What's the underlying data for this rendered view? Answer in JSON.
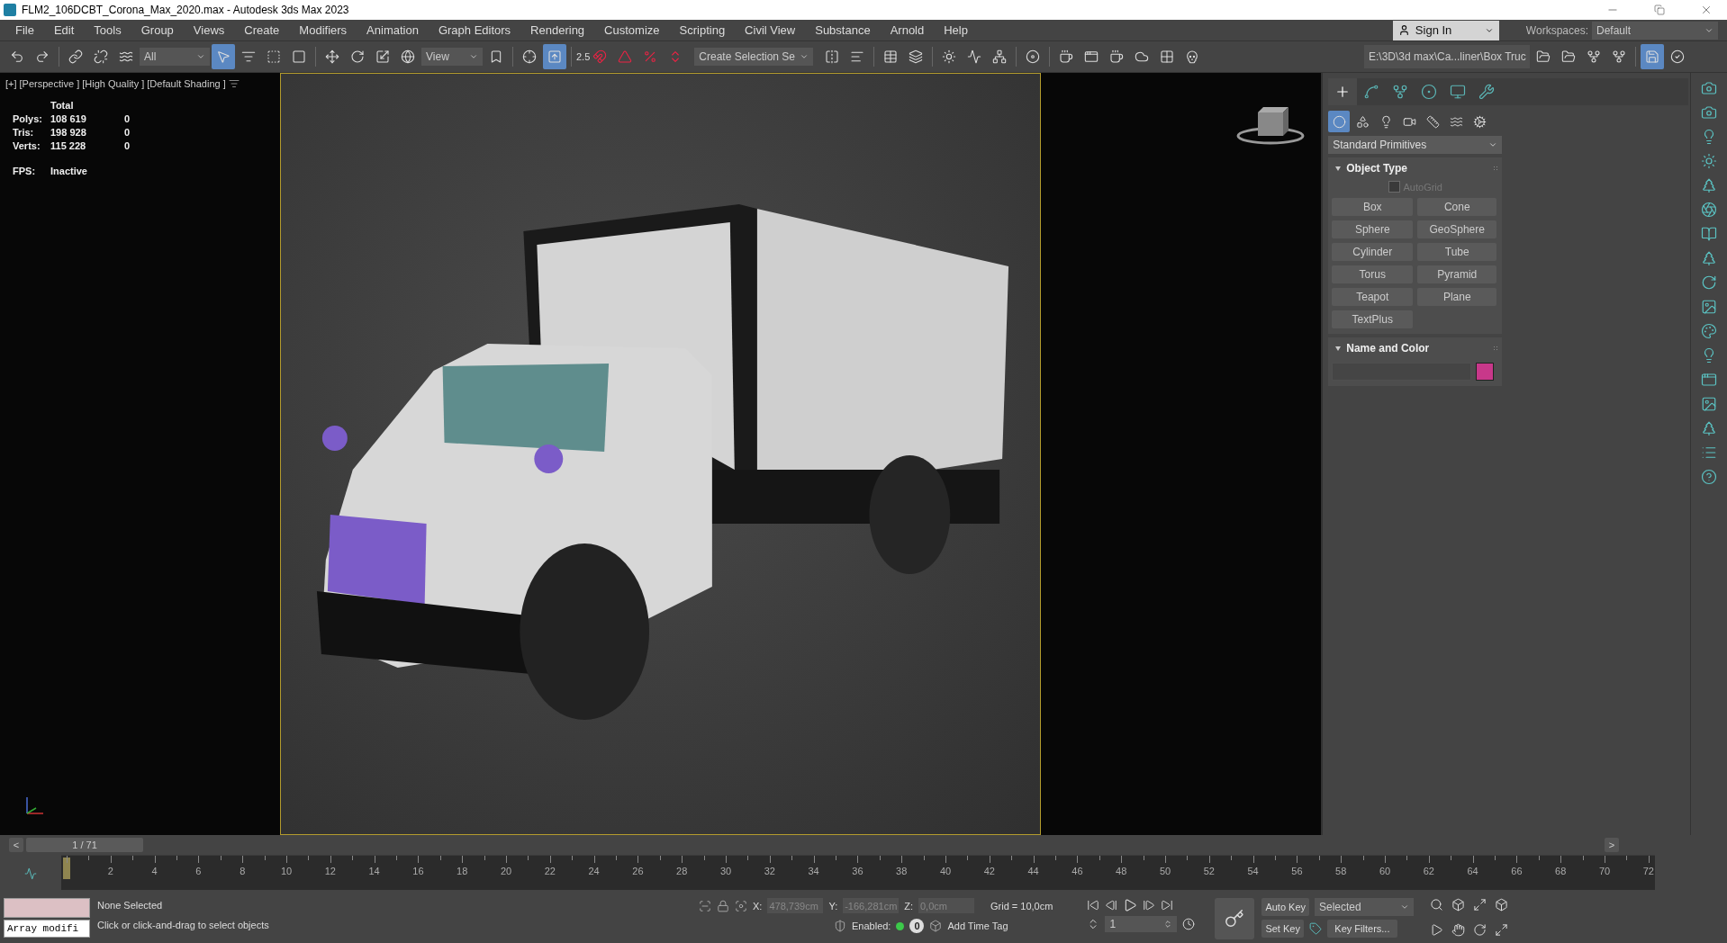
{
  "window": {
    "title": "FLM2_106DCBT_Corona_Max_2020.max - Autodesk 3ds Max 2023"
  },
  "menu": [
    "File",
    "Edit",
    "Tools",
    "Group",
    "Views",
    "Create",
    "Modifiers",
    "Animation",
    "Graph Editors",
    "Rendering",
    "Customize",
    "Scripting",
    "Civil View",
    "Substance",
    "Arnold",
    "Help"
  ],
  "account": {
    "sign_in": "Sign In",
    "workspaces_label": "Workspaces:",
    "workspace": "Default"
  },
  "toolbar": {
    "selection_filter": "All",
    "reference_coord": "View",
    "snap_label": "2.5",
    "selection_set": "Create Selection Se",
    "project_path": "E:\\3D\\3d max\\Ca...liner\\Box Truc",
    "tools": [
      {
        "kind": "undo",
        "selected": false
      },
      {
        "kind": "redo",
        "selected": false
      },
      {
        "kind": "sep"
      },
      {
        "kind": "link",
        "selected": false
      },
      {
        "kind": "unlink",
        "selected": false
      },
      {
        "kind": "bind",
        "selected": false
      },
      {
        "kind": "filter"
      },
      {
        "kind": "select",
        "selected": true
      },
      {
        "kind": "select-name",
        "selected": false
      },
      {
        "kind": "region",
        "selected": false
      },
      {
        "kind": "window",
        "selected": false
      },
      {
        "kind": "sep"
      },
      {
        "kind": "move",
        "selected": false
      },
      {
        "kind": "rotate",
        "selected": false
      },
      {
        "kind": "scale",
        "selected": false
      },
      {
        "kind": "place",
        "selected": false
      },
      {
        "kind": "coord"
      },
      {
        "kind": "bookmark",
        "selected": false
      },
      {
        "kind": "sep"
      },
      {
        "kind": "pivot",
        "selected": false
      },
      {
        "kind": "override",
        "selected": true
      },
      {
        "kind": "sep"
      },
      {
        "kind": "snap",
        "selected": false
      },
      {
        "kind": "angle",
        "selected": false
      },
      {
        "kind": "percent",
        "selected": false
      },
      {
        "kind": "spinner",
        "selected": false
      },
      {
        "kind": "selset"
      },
      {
        "kind": "mirror",
        "selected": false
      },
      {
        "kind": "align",
        "selected": false
      },
      {
        "kind": "sep"
      },
      {
        "kind": "table",
        "selected": false
      },
      {
        "kind": "layers",
        "selected": false
      },
      {
        "kind": "sep"
      },
      {
        "kind": "sun",
        "selected": false
      },
      {
        "kind": "curve",
        "selected": false
      },
      {
        "kind": "schematic",
        "selected": false
      },
      {
        "kind": "sep"
      },
      {
        "kind": "material",
        "selected": false
      },
      {
        "kind": "sep"
      },
      {
        "kind": "render-setup",
        "selected": false
      },
      {
        "kind": "frame-window",
        "selected": false
      },
      {
        "kind": "render",
        "selected": false
      },
      {
        "kind": "render-cloud",
        "selected": false
      },
      {
        "kind": "grid",
        "selected": false
      },
      {
        "kind": "skull",
        "selected": false
      },
      {
        "kind": "path"
      },
      {
        "kind": "folder",
        "selected": false
      },
      {
        "kind": "folder",
        "selected": false
      },
      {
        "kind": "hierarchy",
        "selected": false
      },
      {
        "kind": "hierarchy",
        "selected": false
      },
      {
        "kind": "sep"
      },
      {
        "kind": "save",
        "selected": true
      },
      {
        "kind": "check"
      }
    ]
  },
  "viewport": {
    "labels": [
      "[+]",
      "[Perspective ]",
      "[High Quality ]",
      "[Default Shading ]"
    ],
    "stats": {
      "header": "Total",
      "rows": [
        {
          "label": "Polys:",
          "total": "108 619",
          "selected": "0"
        },
        {
          "label": "Tris:",
          "total": "198 928",
          "selected": "0"
        },
        {
          "label": "Verts:",
          "total": "115 228",
          "selected": "0"
        }
      ],
      "fps_label": "FPS:",
      "fps": "Inactive"
    }
  },
  "command_panel": {
    "tabs": [
      {
        "kind": "create",
        "selected": true
      },
      {
        "kind": "modify",
        "selected": false
      },
      {
        "kind": "hierarchy",
        "selected": false
      },
      {
        "kind": "motion",
        "selected": false
      },
      {
        "kind": "display",
        "selected": false
      },
      {
        "kind": "utilities",
        "selected": false
      }
    ],
    "categories": [
      {
        "kind": "geometry",
        "selected": true
      },
      {
        "kind": "shapes",
        "selected": false
      },
      {
        "kind": "lights",
        "selected": false
      },
      {
        "kind": "cameras",
        "selected": false
      },
      {
        "kind": "helpers",
        "selected": false
      },
      {
        "kind": "spacewarps",
        "selected": false
      },
      {
        "kind": "systems",
        "selected": false
      }
    ],
    "category_dropdown": "Standard Primitives",
    "object_type": {
      "title": "Object Type",
      "expanded": true,
      "autogrid": {
        "label": "AutoGrid",
        "checked": false
      },
      "buttons": [
        "Box",
        "Cone",
        "Sphere",
        "GeoSphere",
        "Cylinder",
        "Tube",
        "Torus",
        "Pyramid",
        "Teapot",
        "Plane",
        "TextPlus"
      ]
    },
    "name_and_color": {
      "title": "Name and Color",
      "expanded": true,
      "color": "#c8388a"
    }
  },
  "timeline": {
    "prev": "<",
    "frame": "1 / 71",
    "level": 0,
    "next": ">",
    "ticks": [
      "2",
      "4",
      "6",
      "8",
      "10",
      "12",
      "14",
      "16",
      "18",
      "20",
      "22",
      "24",
      "26",
      "28",
      "30",
      "32",
      "34",
      "36",
      "38",
      "40",
      "42",
      "44",
      "46",
      "48",
      "50",
      "52",
      "54",
      "56",
      "58",
      "60",
      "62",
      "64",
      "66",
      "68",
      "70",
      "72"
    ]
  },
  "status": {
    "listener": "Array modifi",
    "selection": "None Selected",
    "prompt": "Click or click-and-drag to select objects",
    "x_label": "X:",
    "x": "478,739cm",
    "y_label": "Y:",
    "y": "-166,281cm",
    "z_label": "Z:",
    "z": "0,0cm",
    "grid": "Grid = 10,0cm",
    "enabled_label": "Enabled:",
    "enabled": true,
    "tag_count": "0",
    "add_time_tag": "Add Time Tag",
    "current_frame": "1",
    "auto_key": "Auto Key",
    "key_mode": "Selected",
    "set_key": "Set Key",
    "key_filters": "Key Filters..."
  }
}
